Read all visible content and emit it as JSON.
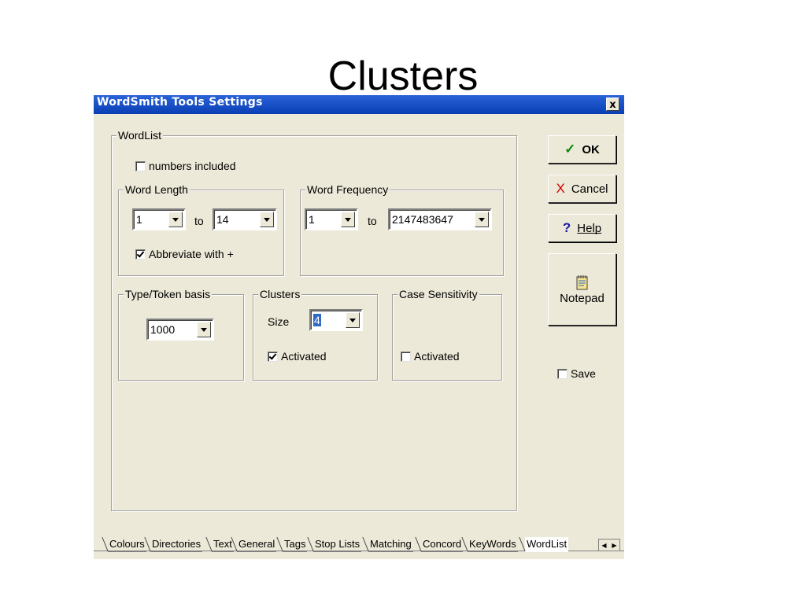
{
  "slide": {
    "title": "Clusters"
  },
  "window": {
    "title": "WordSmith Tools Settings",
    "close_glyph": "x"
  },
  "wordlist": {
    "legend": "WordList",
    "numbers_included": {
      "label": "numbers included",
      "checked": false
    },
    "word_length": {
      "legend": "Word Length",
      "from": "1",
      "to_label": "to",
      "to": "14",
      "abbreviate": {
        "label": "Abbreviate with +",
        "checked": true
      }
    },
    "word_frequency": {
      "legend": "Word Frequency",
      "from": "1",
      "to_label": "to",
      "to": "2147483647"
    },
    "type_token": {
      "legend": "Type/Token basis",
      "value": "1000"
    },
    "clusters": {
      "legend": "Clusters",
      "size_label": "Size",
      "size": "4",
      "activated": {
        "label": "Activated",
        "checked": true
      }
    },
    "case_sensitivity": {
      "legend": "Case Sensitivity",
      "activated": {
        "label": "Activated",
        "checked": false
      }
    }
  },
  "buttons": {
    "ok": {
      "glyph": "✓",
      "label": "OK",
      "color": "#0a8a0a"
    },
    "cancel": {
      "glyph": "X",
      "label": "Cancel",
      "color": "#d40000"
    },
    "help": {
      "glyph": "?",
      "label": "Help",
      "color": "#1a1ab0"
    },
    "notepad": {
      "label": "Notepad"
    },
    "save": {
      "label": "Save",
      "checked": false
    }
  },
  "tabs": [
    {
      "label": "Colours"
    },
    {
      "label": "Directories"
    },
    {
      "label": "Text"
    },
    {
      "label": "General"
    },
    {
      "label": "Tags"
    },
    {
      "label": "Stop Lists"
    },
    {
      "label": "Matching"
    },
    {
      "label": "Concord"
    },
    {
      "label": "KeyWords"
    },
    {
      "label": "WordList",
      "active": true
    }
  ]
}
